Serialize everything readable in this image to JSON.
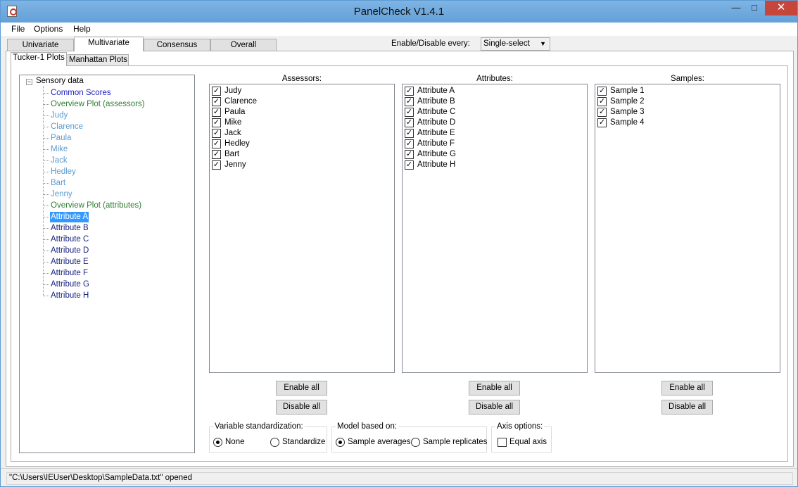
{
  "window": {
    "title": "PanelCheck V1.4.1",
    "minimize": "—",
    "maximize": "□",
    "close": "✕"
  },
  "menu": [
    "File",
    "Options",
    "Help"
  ],
  "tabs": [
    "Univariate",
    "Multivariate",
    "Consensus",
    "Overall"
  ],
  "active_tab": "Multivariate",
  "enable_disable": {
    "label": "Enable/Disable every:",
    "value": "Single-select"
  },
  "subtabs": [
    "Tucker-1 Plots",
    "Manhattan Plots"
  ],
  "tree": {
    "root": "Sensory data",
    "toggle": "−",
    "items": [
      {
        "label": "Common Scores",
        "color": "#1f1fbf"
      },
      {
        "label": "Overview Plot (assessors)",
        "color": "#2e7d32"
      },
      {
        "label": "Judy",
        "color": "#5b9bd0"
      },
      {
        "label": "Clarence",
        "color": "#5b9bd0"
      },
      {
        "label": "Paula",
        "color": "#5b9bd0"
      },
      {
        "label": "Mike",
        "color": "#5b9bd0"
      },
      {
        "label": "Jack",
        "color": "#5b9bd0"
      },
      {
        "label": "Hedley",
        "color": "#5b9bd0"
      },
      {
        "label": "Bart",
        "color": "#5b9bd0"
      },
      {
        "label": "Jenny",
        "color": "#5b9bd0"
      },
      {
        "label": "Overview Plot (attributes)",
        "color": "#2e7d32"
      },
      {
        "label": "Attribute A",
        "color": "#1a237e",
        "selected": true
      },
      {
        "label": "Attribute B",
        "color": "#1a237e"
      },
      {
        "label": "Attribute C",
        "color": "#1a237e"
      },
      {
        "label": "Attribute D",
        "color": "#1a237e"
      },
      {
        "label": "Attribute E",
        "color": "#1a237e"
      },
      {
        "label": "Attribute F",
        "color": "#1a237e"
      },
      {
        "label": "Attribute G",
        "color": "#1a237e"
      },
      {
        "label": "Attribute H",
        "color": "#1a237e"
      }
    ]
  },
  "columns": {
    "assessors": {
      "title": "Assessors:",
      "items": [
        "Judy",
        "Clarence",
        "Paula",
        "Mike",
        "Jack",
        "Hedley",
        "Bart",
        "Jenny"
      ]
    },
    "attributes": {
      "title": "Attributes:",
      "items": [
        "Attribute A",
        "Attribute B",
        "Attribute C",
        "Attribute D",
        "Attribute E",
        "Attribute F",
        "Attribute G",
        "Attribute H"
      ]
    },
    "samples": {
      "title": "Samples:",
      "items": [
        "Sample 1",
        "Sample 2",
        "Sample 3",
        "Sample 4"
      ]
    }
  },
  "check_mark": "✓",
  "buttons": {
    "enable_all": "Enable all",
    "disable_all": "Disable all"
  },
  "variable_standardization": {
    "title": "Variable standardization:",
    "options": [
      "None",
      "Standardize"
    ],
    "selected": "None"
  },
  "model_based_on": {
    "title": "Model based on:",
    "options": [
      "Sample averages",
      "Sample replicates"
    ],
    "selected": "Sample averages"
  },
  "axis_options": {
    "title": "Axis options:",
    "equal_axis": "Equal axis",
    "equal_axis_checked": false
  },
  "status": "\"C:\\Users\\IEUser\\Desktop\\SampleData.txt\" opened"
}
